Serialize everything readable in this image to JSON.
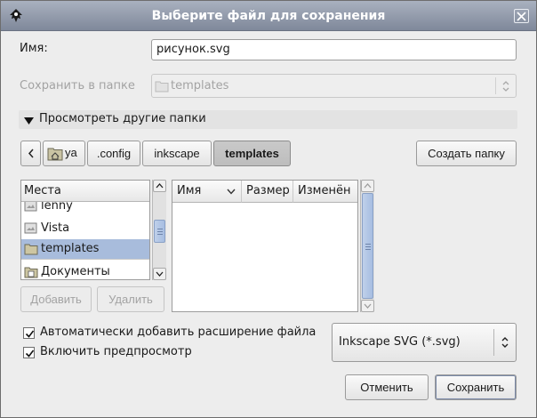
{
  "window": {
    "title": "Выберите файл для сохранения"
  },
  "name_row": {
    "label": "Имя:",
    "value": "рисунок.svg"
  },
  "folder_row": {
    "label": "Сохранить в папке",
    "value": "templates"
  },
  "expander": {
    "label": "Просмотреть другие папки"
  },
  "path_bar": {
    "items": [
      {
        "label": "ya",
        "icon": "home-folder-icon"
      },
      {
        "label": ".config"
      },
      {
        "label": "inkscape"
      },
      {
        "label": "templates",
        "active": true
      }
    ],
    "create_folder_label": "Создать папку"
  },
  "places": {
    "header": "Места",
    "items": [
      {
        "label": "lenny",
        "icon": "drive-icon"
      },
      {
        "label": "Vista",
        "icon": "drive-icon"
      },
      {
        "label": "templates",
        "icon": "folder-icon",
        "selected": true
      },
      {
        "label": "Документы",
        "icon": "folder-icon"
      }
    ],
    "add_label": "Добавить",
    "remove_label": "Удалить"
  },
  "files": {
    "columns": [
      "Имя",
      "Размер",
      "Изменён"
    ],
    "rows": []
  },
  "options": {
    "auto_extension_label": "Автоматически добавить расширение файла",
    "auto_extension_checked": true,
    "preview_label": "Включить предпросмотр",
    "preview_checked": true
  },
  "filter": {
    "value": "Inkscape SVG (*.svg)"
  },
  "buttons": {
    "cancel_label": "Отменить",
    "save_label": "Сохранить"
  },
  "colors": {
    "titlebar": "#8f98aa",
    "selection": "#a8bcdc",
    "dialog_bg": "#ededed"
  }
}
